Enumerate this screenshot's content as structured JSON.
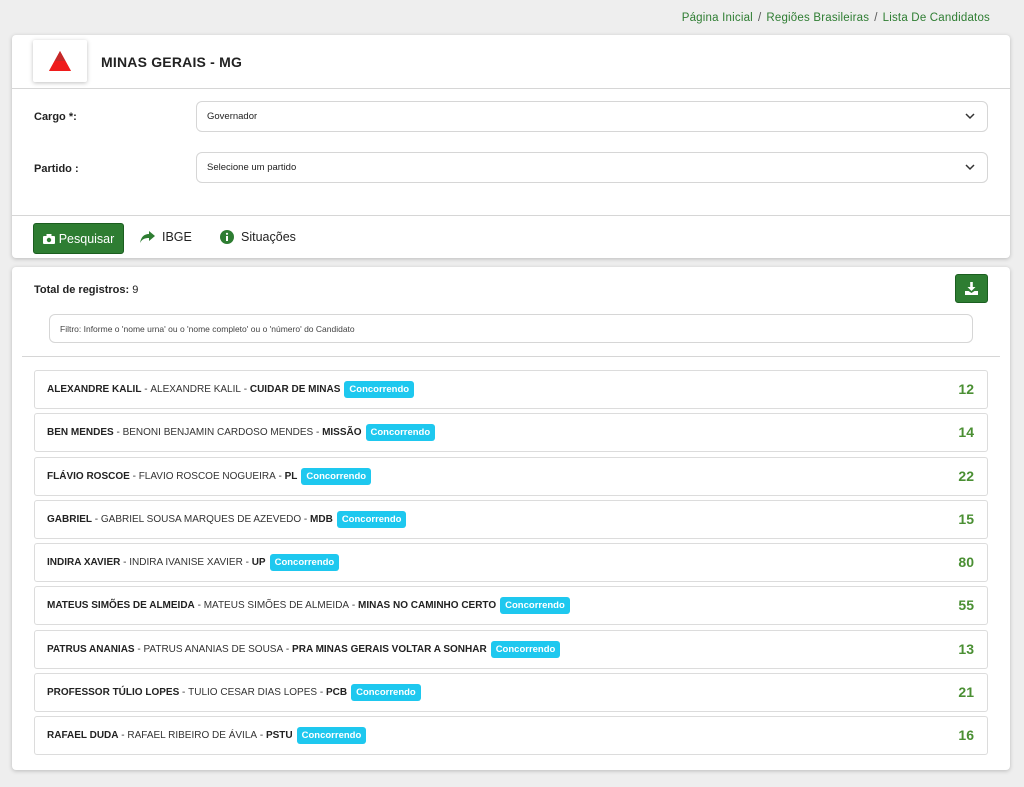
{
  "breadcrumb": [
    {
      "label": "Página Inicial"
    },
    {
      "label": "Regiões Brasileiras"
    },
    {
      "label": "Lista De Candidatos"
    }
  ],
  "header": {
    "state_title": "MINAS GERAIS - MG",
    "logo_icon": "minas-gerais-triangle-icon"
  },
  "form": {
    "cargo_label": "Cargo *:",
    "cargo_value": "Governador",
    "partido_label": "Partido :",
    "partido_value": "Selecione um partido"
  },
  "actions": {
    "search_label": "Pesquisar",
    "ibge_label": "IBGE",
    "situacoes_label": "Situações"
  },
  "list": {
    "total_label": "Total de registros:",
    "total_value": "9",
    "filter_placeholder": "Filtro: Informe o 'nome urna' ou o 'nome completo' ou o 'número' do Candidato",
    "candidates": [
      {
        "nick": "ALEXANDRE KALIL",
        "full": "ALEXANDRE KALIL",
        "party": "CUIDAR DE MINAS",
        "status": "Concorrendo",
        "number": "12"
      },
      {
        "nick": "BEN MENDES",
        "full": "BENONI BENJAMIN CARDOSO MENDES",
        "party": "MISSÃO",
        "status": "Concorrendo",
        "number": "14"
      },
      {
        "nick": "FLÁVIO ROSCOE",
        "full": "FLAVIO ROSCOE NOGUEIRA",
        "party": "PL",
        "status": "Concorrendo",
        "number": "22"
      },
      {
        "nick": "GABRIEL",
        "full": "GABRIEL SOUSA MARQUES DE AZEVEDO",
        "party": "MDB",
        "status": "Concorrendo",
        "number": "15"
      },
      {
        "nick": "INDIRA XAVIER",
        "full": "INDIRA IVANISE XAVIER",
        "party": "UP",
        "status": "Concorrendo",
        "number": "80"
      },
      {
        "nick": "MATEUS SIMÕES DE ALMEIDA",
        "full": "MATEUS SIMÕES DE ALMEIDA",
        "party": "MINAS NO CAMINHO CERTO",
        "status": "Concorrendo",
        "number": "55"
      },
      {
        "nick": "PATRUS ANANIAS",
        "full": "PATRUS ANANIAS DE SOUSA",
        "party": "PRA MINAS GERAIS VOLTAR A SONHAR",
        "status": "Concorrendo",
        "number": "13"
      },
      {
        "nick": "PROFESSOR TÚLIO LOPES",
        "full": "TULIO CESAR DIAS LOPES",
        "party": "PCB",
        "status": "Concorrendo",
        "number": "21"
      },
      {
        "nick": "RAFAEL DUDA",
        "full": "RAFAEL RIBEIRO DE ÁVILA",
        "party": "PSTU",
        "status": "Concorrendo",
        "number": "16"
      }
    ]
  },
  "colors": {
    "primary": "#2e7d32",
    "badge": "#1ec8ef",
    "number": "#4a8f33",
    "logo_red": "#e53935"
  }
}
